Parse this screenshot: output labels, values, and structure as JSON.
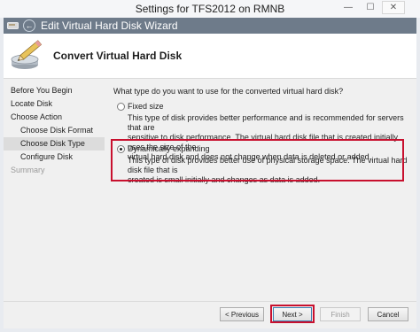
{
  "outer_window": {
    "title": "Settings for TFS2012 on RMNB",
    "controls": {
      "minimize": "—",
      "maximize": "☐",
      "close": "✕"
    }
  },
  "wizard": {
    "title": "Edit Virtual Hard Disk Wizard",
    "back_glyph": "←",
    "titlebar_color": "#6e7b8a"
  },
  "header": {
    "title": "Convert Virtual Hard Disk",
    "icon": "disk-pencil-icon"
  },
  "nav": {
    "items": [
      {
        "label": "Before You Begin"
      },
      {
        "label": "Locate Disk"
      },
      {
        "label": "Choose Action"
      },
      {
        "label": "Choose Disk Format"
      },
      {
        "label": "Choose Disk Type"
      },
      {
        "label": "Configure Disk"
      },
      {
        "label": "Summary"
      }
    ],
    "active_index": 4
  },
  "content": {
    "question": "What type do you want to use for the converted virtual hard disk?",
    "options": [
      {
        "label": "Fixed size",
        "selected": false,
        "description_lines": [
          "This type of disk provides better performance and is recommended for servers that are",
          "sensitive to disk performance. The virtual hard disk file that is created initially uses the size of the",
          "virtual hard disk and does not change when data is deleted or added."
        ]
      },
      {
        "label": "Dynamically expanding",
        "selected": true,
        "description_lines": [
          "This type of disk provides better use of physical storage space. The virtual hard disk file that is",
          "created is small initially and changes as data is added."
        ]
      }
    ],
    "highlight_color": "#c8102e"
  },
  "footer": {
    "previous_label": "< Previous",
    "next_label": "Next >",
    "finish_label": "Finish",
    "cancel_label": "Cancel"
  }
}
